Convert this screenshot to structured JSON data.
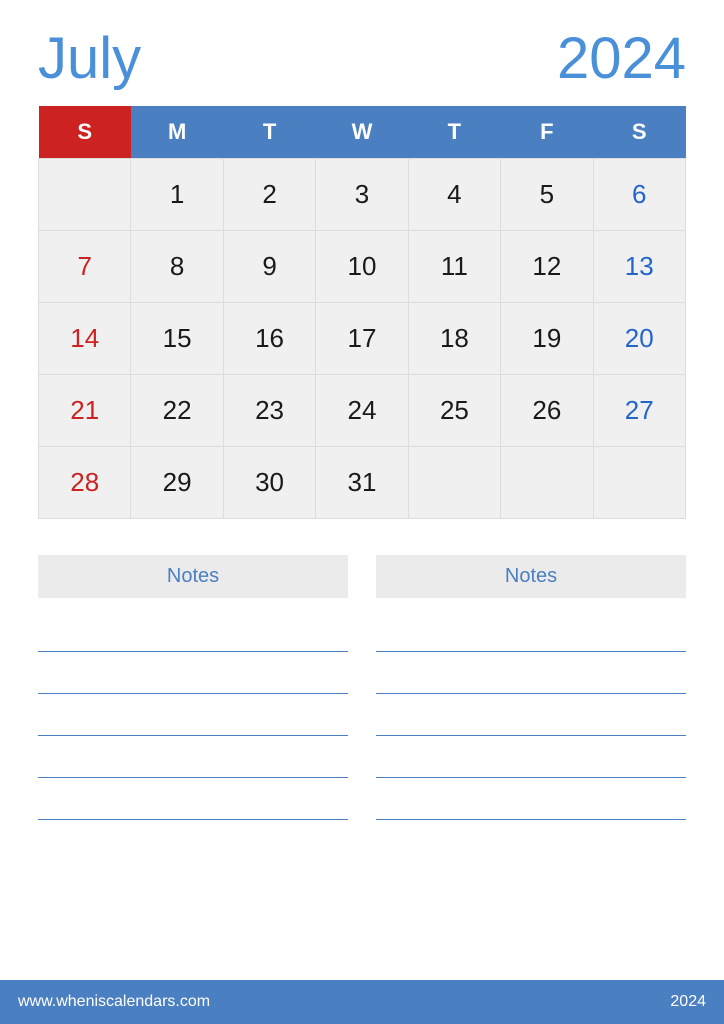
{
  "header": {
    "month": "July",
    "year": "2024"
  },
  "calendar": {
    "days_header": [
      "S",
      "M",
      "T",
      "W",
      "T",
      "F",
      "S"
    ],
    "weeks": [
      [
        "",
        "1",
        "2",
        "3",
        "4",
        "5",
        "6"
      ],
      [
        "7",
        "8",
        "9",
        "10",
        "11",
        "12",
        "13"
      ],
      [
        "14",
        "15",
        "16",
        "17",
        "18",
        "19",
        "20"
      ],
      [
        "21",
        "22",
        "23",
        "24",
        "25",
        "26",
        "27"
      ],
      [
        "28",
        "29",
        "30",
        "31",
        "",
        "",
        ""
      ]
    ]
  },
  "notes": {
    "left_label": "Notes",
    "right_label": "Notes",
    "line_count": 5
  },
  "footer": {
    "url": "www.wheniscalendars.com",
    "year": "2024"
  }
}
